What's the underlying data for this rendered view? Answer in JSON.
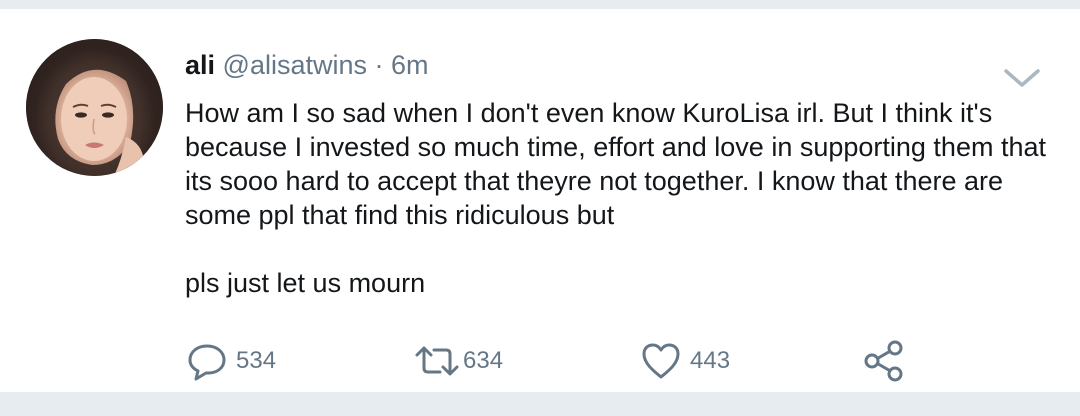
{
  "tweet": {
    "name": "ali",
    "handle": "@alisatwins",
    "separator": "·",
    "time": "6m",
    "text_p1": "How am I so sad when I don't even know KuroLisa irl. But I think it's because I invested so much time, effort and love in supporting them that its sooo hard to accept that theyre not together. I know that there are some ppl that find this ridiculous but",
    "text_p2": "pls just let us mourn"
  },
  "actions": {
    "replies": "534",
    "retweets": "634",
    "likes": "443"
  },
  "icons": {
    "reply": "speech-bubble-icon",
    "retweet": "retweet-arrows-icon",
    "like": "heart-icon",
    "share": "share-nodes-icon",
    "menu": "chevron-down-icon"
  },
  "colors": {
    "text": "#14171a",
    "muted": "#657786",
    "divider": "#e6ecf0"
  }
}
